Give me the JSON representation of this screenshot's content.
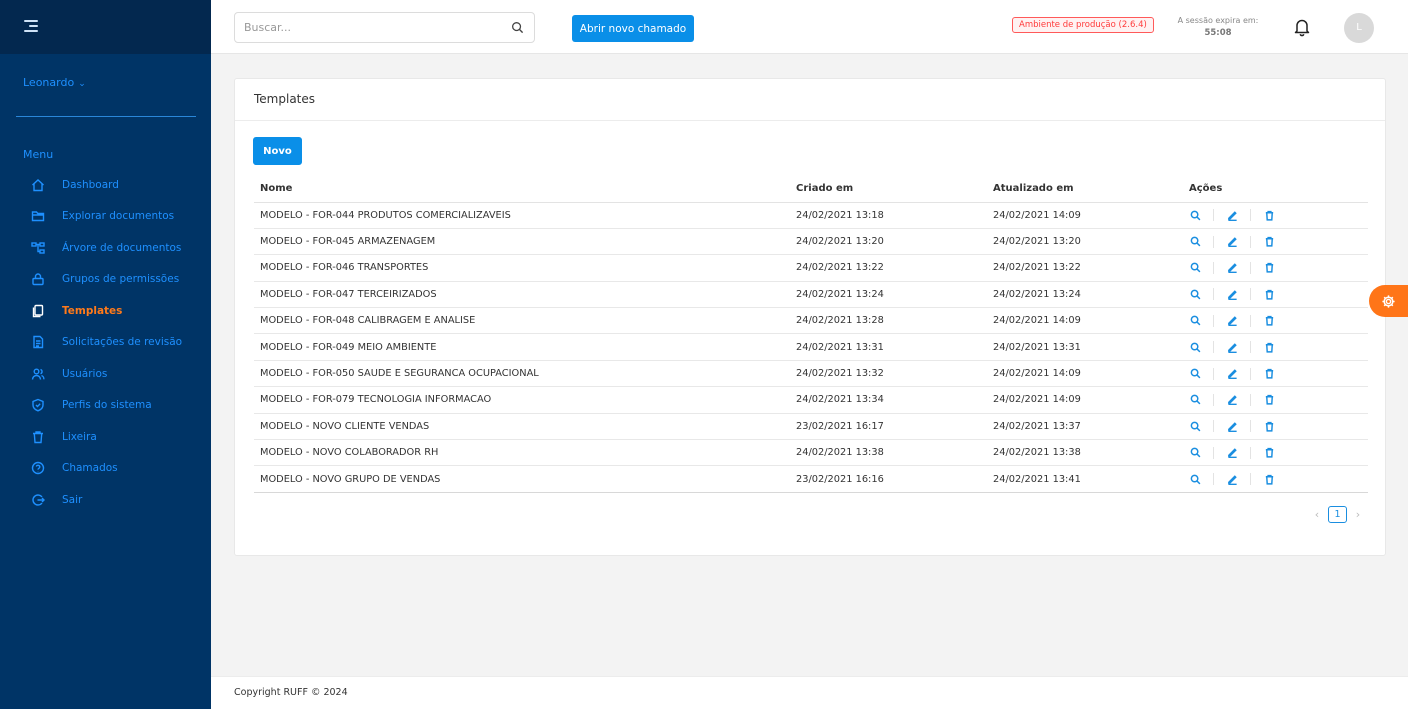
{
  "sidebar": {
    "user_name": "Leonardo",
    "menu_heading": "Menu",
    "items": [
      {
        "label": "Dashboard",
        "icon": "home-icon"
      },
      {
        "label": "Explorar documentos",
        "icon": "folder-icon"
      },
      {
        "label": "Árvore de documentos",
        "icon": "tree-icon"
      },
      {
        "label": "Grupos de permissões",
        "icon": "lock-icon"
      },
      {
        "label": "Templates",
        "icon": "copy-icon",
        "active": true
      },
      {
        "label": "Solicitações de revisão",
        "icon": "document-icon"
      },
      {
        "label": "Usuários",
        "icon": "users-icon"
      },
      {
        "label": "Perfis do sistema",
        "icon": "shield-icon"
      },
      {
        "label": "Lixeira",
        "icon": "trash-icon"
      },
      {
        "label": "Chamados",
        "icon": "help-icon"
      },
      {
        "label": "Sair",
        "icon": "logout-icon"
      }
    ]
  },
  "header": {
    "search_placeholder": "Buscar...",
    "new_ticket_label": "Abrir novo chamado",
    "env_badge": "Ambiente de produção (2.6.4)",
    "session_label": "A sessão expira em:",
    "session_time": "55:08",
    "avatar_initial": "L"
  },
  "card": {
    "title": "Templates",
    "new_button": "Novo",
    "columns": [
      "Nome",
      "Criado em",
      "Atualizado em",
      "Ações"
    ],
    "rows": [
      {
        "nome": "MODELO - FOR-044 PRODUTOS COMERCIALIZAVEIS",
        "criado": "24/02/2021 13:18",
        "atualizado": "24/02/2021 14:09"
      },
      {
        "nome": "MODELO - FOR-045 ARMAZENAGEM",
        "criado": "24/02/2021 13:20",
        "atualizado": "24/02/2021 13:20"
      },
      {
        "nome": "MODELO - FOR-046 TRANSPORTES",
        "criado": "24/02/2021 13:22",
        "atualizado": "24/02/2021 13:22"
      },
      {
        "nome": "MODELO - FOR-047 TERCEIRIZADOS",
        "criado": "24/02/2021 13:24",
        "atualizado": "24/02/2021 13:24"
      },
      {
        "nome": "MODELO - FOR-048 CALIBRAGEM E ANALISE",
        "criado": "24/02/2021 13:28",
        "atualizado": "24/02/2021 14:09"
      },
      {
        "nome": "MODELO - FOR-049 MEIO AMBIENTE",
        "criado": "24/02/2021 13:31",
        "atualizado": "24/02/2021 13:31"
      },
      {
        "nome": "MODELO - FOR-050 SAUDE E SEGURANCA OCUPACIONAL",
        "criado": "24/02/2021 13:32",
        "atualizado": "24/02/2021 14:09"
      },
      {
        "nome": "MODELO - FOR-079 TECNOLOGIA INFORMACAO",
        "criado": "24/02/2021 13:34",
        "atualizado": "24/02/2021 14:09"
      },
      {
        "nome": "MODELO - NOVO CLIENTE VENDAS",
        "criado": "23/02/2021 16:17",
        "atualizado": "24/02/2021 13:37"
      },
      {
        "nome": "MODELO - NOVO COLABORADOR RH",
        "criado": "24/02/2021 13:38",
        "atualizado": "24/02/2021 13:38"
      },
      {
        "nome": "MODELO - NOVO GRUPO DE VENDAS",
        "criado": "23/02/2021 16:16",
        "atualizado": "24/02/2021 13:41"
      }
    ],
    "pagination": {
      "current_page": "1",
      "prev": "‹",
      "next": "›"
    }
  },
  "footer": {
    "copyright": "Copyright RUFF © 2024"
  },
  "colors": {
    "sidebar": "#003466",
    "accent": "#0a8fe8",
    "active": "#ff7a1a",
    "env_badge": "#ff3b3b"
  }
}
